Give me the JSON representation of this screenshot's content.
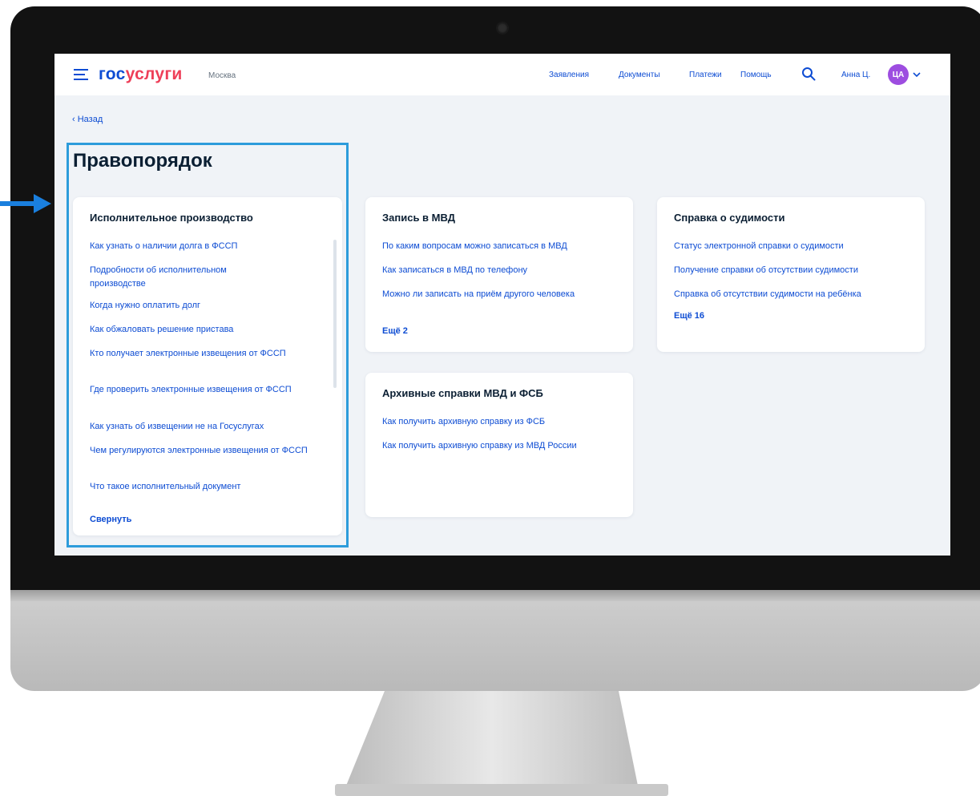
{
  "header": {
    "logo_part1": "гос",
    "logo_part2": "услуги",
    "city": "Москва",
    "nav": [
      "Заявления",
      "Документы",
      "Платежи",
      "Помощь"
    ],
    "user_name": "Анна Ц.",
    "avatar_initials": "ЦА"
  },
  "back_label": "Назад",
  "page_title": "Правопорядок",
  "cards": {
    "enforcement": {
      "title": "Исполнительное производство",
      "links": [
        "Как узнать о наличии долга в ФССП",
        "Подробности об исполнительном производстве",
        "Когда нужно оплатить долг",
        "Как обжаловать решение пристава",
        "Кто получает электронные извещения от ФССП",
        "Где проверить электронные извещения от ФССП",
        "Как узнать об извещении не на Госуслугах",
        "Чем регулируются электронные извещения от ФССП",
        "Что такое исполнительный документ"
      ],
      "collapse_label": "Свернуть"
    },
    "mvd": {
      "title": "Запись в МВД",
      "links": [
        "По каким вопросам можно записаться в МВД",
        "Как записаться в МВД по телефону",
        "Можно ли записать на приём другого человека"
      ],
      "more_label": "Ещё 2"
    },
    "criminal": {
      "title": "Справка о судимости",
      "links": [
        "Статус электронной справки о судимости",
        "Получение справки об отсутствии судимости",
        "Справка об отсутствии судимости на ребёнка"
      ],
      "more_label": "Ещё 16"
    },
    "archive": {
      "title": "Архивные справки МВД и ФСБ",
      "links": [
        "Как получить архивную справку из ФСБ",
        "Как получить архивную справку из МВД России"
      ]
    }
  },
  "colors": {
    "brand_blue": "#0d4cd3",
    "brand_red": "#ee3f58",
    "highlight": "#2d9cdb",
    "avatar": "#9d4de0"
  }
}
